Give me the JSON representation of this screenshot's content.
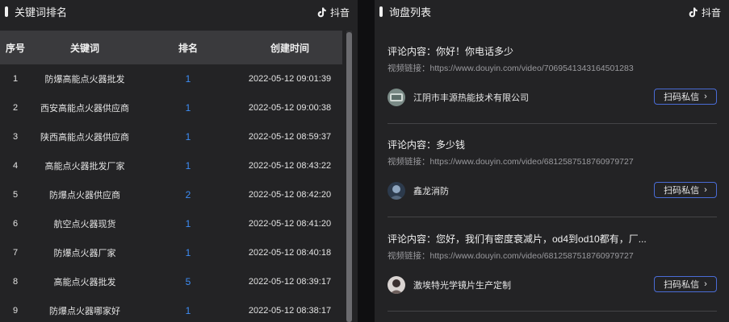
{
  "keyword_panel": {
    "title": "关键词排名",
    "brand": "抖音",
    "columns": [
      "序号",
      "关键词",
      "排名",
      "创建时间"
    ],
    "rows": [
      {
        "no": "1",
        "keyword": "防爆高能点火器批发",
        "rank": "1",
        "time": "2022-05-12 09:01:39"
      },
      {
        "no": "2",
        "keyword": "西安高能点火器供应商",
        "rank": "1",
        "time": "2022-05-12 09:00:38"
      },
      {
        "no": "3",
        "keyword": "陕西高能点火器供应商",
        "rank": "1",
        "time": "2022-05-12 08:59:37"
      },
      {
        "no": "4",
        "keyword": "高能点火器批发厂家",
        "rank": "1",
        "time": "2022-05-12 08:43:22"
      },
      {
        "no": "5",
        "keyword": "防爆点火器供应商",
        "rank": "2",
        "time": "2022-05-12 08:42:20"
      },
      {
        "no": "6",
        "keyword": "航空点火器现货",
        "rank": "1",
        "time": "2022-05-12 08:41:20"
      },
      {
        "no": "7",
        "keyword": "防爆点火器厂家",
        "rank": "1",
        "time": "2022-05-12 08:40:18"
      },
      {
        "no": "8",
        "keyword": "高能点火器批发",
        "rank": "5",
        "time": "2022-05-12 08:39:17"
      },
      {
        "no": "9",
        "keyword": "防爆点火器哪家好",
        "rank": "1",
        "time": "2022-05-12 08:38:17"
      }
    ]
  },
  "inquiry_panel": {
    "title": "询盘列表",
    "brand": "抖音",
    "items": [
      {
        "comment": "评论内容：你好！你电话多少",
        "link": "视频链接：https://www.douyin.com/video/7069541343164501283",
        "user": "江阴市丰源热能技术有限公司",
        "button": "扫码私信"
      },
      {
        "comment": "评论内容：多少钱",
        "link": "视频链接：https://www.douyin.com/video/6812587518760979727",
        "user": "鑫龙消防",
        "button": "扫码私信"
      },
      {
        "comment": "评论内容：您好，我们有密度衰减片，od4到od10都有，厂...",
        "link": "视频链接：https://www.douyin.com/video/6812587518760979727",
        "user": "激埃特光学镜片生产定制",
        "button": "扫码私信"
      }
    ]
  },
  "icons": {
    "brand_icon": "tiktok-icon",
    "chevron": "chevron-right-icon",
    "chevron_glyph": "›"
  },
  "colors": {
    "rank_accent": "#3d8df5",
    "button_border": "#4a6cd6"
  }
}
